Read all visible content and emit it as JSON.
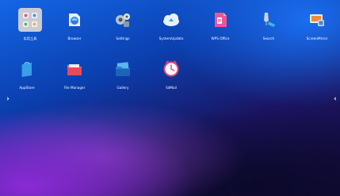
{
  "launcher": {
    "row1": [
      {
        "label": "实用工具",
        "icon": "toolbox-folder-icon"
      },
      {
        "label": "Browser",
        "icon": "browser-icon"
      },
      {
        "label": "Settings",
        "icon": "settings-gear-icon"
      },
      {
        "label": "SystemUpdate",
        "icon": "cloud-update-icon"
      },
      {
        "label": "WPS Office",
        "icon": "wps-office-icon"
      },
      {
        "label": "Search",
        "icon": "search-pen-icon"
      },
      {
        "label": "ScreenMirror",
        "icon": "screen-mirror-icon"
      }
    ],
    "row2": [
      {
        "label": "AppStore",
        "icon": "appstore-bag-icon"
      },
      {
        "label": "File Manager",
        "icon": "folder-icon"
      },
      {
        "label": "Gallery",
        "icon": "gallery-icon"
      },
      {
        "label": "SdMail",
        "icon": "mail-clock-icon"
      }
    ]
  },
  "nav": {
    "left": "›",
    "right": "‹"
  },
  "colors": {
    "bg_blue": "#1466e6",
    "bg_purple": "#8b2ad6",
    "bg_dark": "#120c32",
    "label": "#ffffff"
  }
}
